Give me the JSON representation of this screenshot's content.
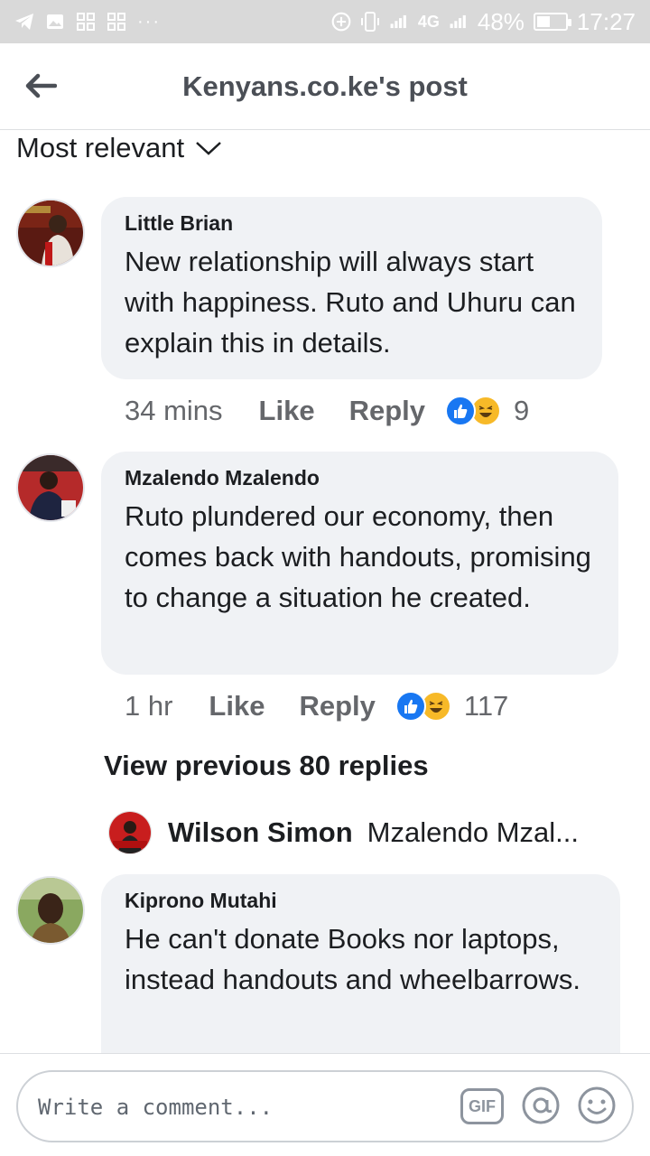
{
  "status_bar": {
    "battery": "48%",
    "time": "17:27",
    "network": "4G",
    "battery_level": 0.48
  },
  "header": {
    "title": "Kenyans.co.ke's post"
  },
  "sort": {
    "label": "Most relevant"
  },
  "comments": [
    {
      "author": "Little Brian",
      "text": "New relationship will always start with happiness. Ruto and Uhuru can explain this in details.",
      "time": "34 mins",
      "like_label": "Like",
      "reply_label": "Reply",
      "reaction_count": "9"
    },
    {
      "author": "Mzalendo Mzalendo",
      "text": "Ruto plundered our economy, then comes back with handouts, promising to change a situation he created.",
      "time": "1 hr",
      "like_label": "Like",
      "reply_label": "Reply",
      "reaction_count": "117"
    },
    {
      "author": "Kiprono Mutahi",
      "text": "He can't donate Books nor laptops, instead handouts and wheelbarrows."
    }
  ],
  "view_previous": "View previous 80 replies",
  "reply_preview": {
    "name": "Wilson Simon",
    "snippet": "Mzalendo Mzal..."
  },
  "composer": {
    "placeholder": "Write a comment...",
    "gif_label": "GIF"
  },
  "colors": {
    "status_bar": "#d9d9d9",
    "bubble": "#f0f2f5",
    "like_blue": "#1877f2",
    "haha_yellow": "#f7b928"
  }
}
